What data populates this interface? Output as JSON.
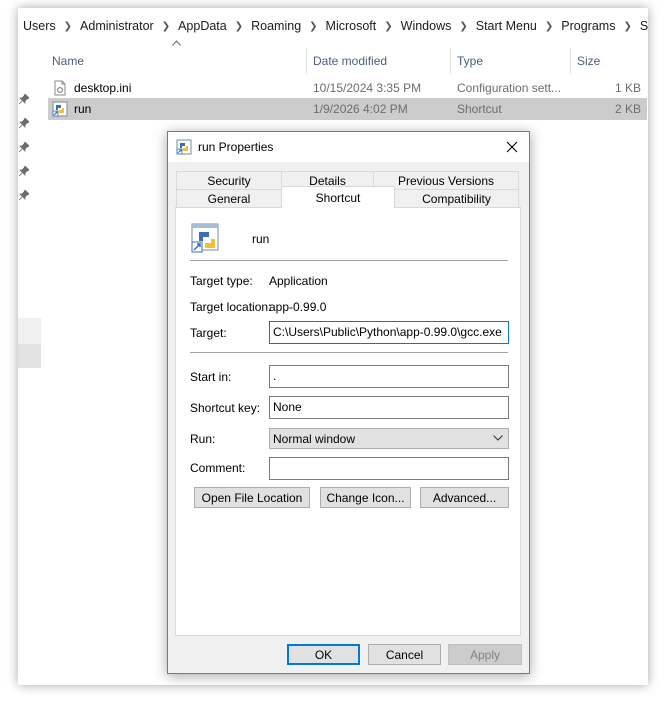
{
  "breadcrumb": [
    "Users",
    "Administrator",
    "AppData",
    "Roaming",
    "Microsoft",
    "Windows",
    "Start Menu",
    "Programs",
    "Startup"
  ],
  "columns": {
    "name": "Name",
    "date_modified": "Date modified",
    "type": "Type",
    "size": "Size"
  },
  "files": [
    {
      "name": "desktop.ini",
      "date": "10/15/2024 3:35 PM",
      "type": "Configuration sett...",
      "size": "1 KB",
      "icon": "settings-file-icon"
    },
    {
      "name": "run",
      "date": "1/9/2026 4:02 PM",
      "type": "Shortcut",
      "size": "2 KB",
      "icon": "python-shortcut-icon"
    }
  ],
  "dialog": {
    "title": "run Properties",
    "tabs_row1": [
      "Security",
      "Details",
      "Previous Versions"
    ],
    "tabs_row2": [
      "General",
      "Shortcut",
      "Compatibility"
    ],
    "active_tab": "Shortcut",
    "shortcut_name": "run",
    "target_type_label": "Target type:",
    "target_type_value": "Application",
    "target_location_label": "Target location:",
    "target_location_value": "app-0.99.0",
    "target_label": "Target:",
    "target_value": "C:\\Users\\Public\\Python\\app-0.99.0\\gcc.exe",
    "start_in_label": "Start in:",
    "start_in_value": ".",
    "shortcut_key_label": "Shortcut key:",
    "shortcut_key_value": "None",
    "run_label": "Run:",
    "run_value": "Normal window",
    "comment_label": "Comment:",
    "comment_value": "",
    "open_file_location": "Open File Location",
    "change_icon": "Change Icon...",
    "advanced": "Advanced...",
    "ok": "OK",
    "cancel": "Cancel",
    "apply": "Apply"
  },
  "colors": {
    "focus_accent": "#0078d7",
    "selection": "#cccccc",
    "dialog_bg": "#f0f0f0"
  }
}
